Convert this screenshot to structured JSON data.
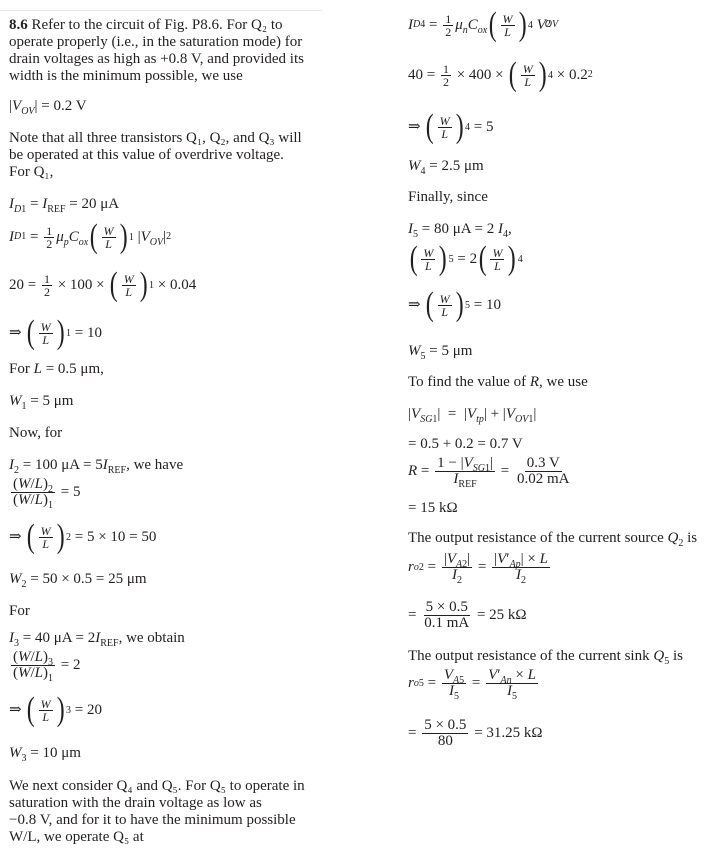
{
  "problem": {
    "number": "8.6",
    "intro": [
      "Refer to the circuit of Fig. P8.6. For Q₂ to",
      "operate properly (i.e., in the saturation mode) for",
      "drain voltages as high as +0.8 V, and provided its",
      "width is the minimum possible, we use"
    ]
  },
  "left": {
    "vov": "|V_OV| = 0.2 V",
    "note": [
      "Note that all three transistors Q₁, Q₂, and Q₃ will",
      "be operated at this value of overdrive voltage.",
      "For Q₁,"
    ],
    "id1_iref": "I_D1 = I_REF = 20 μA",
    "id1_formula": "I_D1 = ½ μ_p C_ox (W/L)_1 |V_OV|²",
    "eq20": "20 = ½ × 100 × (W/L)_1 × 0.04",
    "wl1": "⇒ (W/L)_1 = 10",
    "for_l": "For L = 0.5 μm,",
    "w1": "W₁ = 5 μm",
    "now_for": "Now, for",
    "i2": "I₂ = 100 μA = 5I_REF, we have",
    "ratio2": "(W/L)₂ / (W/L)₁ = 5",
    "wl2": "⇒ (W/L)_2 = 5 × 10 = 50",
    "w2": "W₂ = 50 × 0.5 = 25 μm",
    "for": "For",
    "i3": "I₃ = 40 μA = 2I_REF, we obtain",
    "ratio3": "(W/L)₃ / (W/L)₁ = 2",
    "wl3": "⇒ (W/L)_3 = 20",
    "w3": "W₃ = 10 μm",
    "next": [
      "We next consider Q₄ and Q₅. For Q₅ to operate in",
      "saturation with the drain voltage as low as",
      "−0.8 V, and for it to have the minimum possible",
      "W/L, we operate Q₅ at"
    ]
  },
  "right": {
    "id4_formula": "I_D4 = ½ μ_n C_ox (W/L)_4 V_OV²",
    "eq40": "40 = ½ × 400 × (W/L)_4 × 0.2²",
    "wl4": "⇒ (W/L)_4 = 5",
    "w4": "W₄ = 2.5 μm",
    "finally": "Finally, since",
    "i5": "I₅ = 80 μA = 2 I₄,",
    "wl5_rel": "(W/L)_5 = 2(W/L)_4",
    "wl5": "⇒ (W/L)_5 = 10",
    "w5": "W₅ = 5 μm",
    "find_r": "To find the value of R, we use",
    "vsg1": "|V_SG1| = |V_tp| + |V_OV1|",
    "vsg1_val": "= 0.5 + 0.2 = 0.7 V",
    "r_formula": "R = (1 − |V_SG1|) / I_REF = 0.3 V / 0.02 mA",
    "r_val": "= 15 kΩ",
    "ro2_text": "The output resistance of the current source Q₂ is",
    "ro2_formula": "r_o2 = |V_A2| / I₂ = |V'_Ap| × L / I₂",
    "ro2_val": "= (5 × 0.5) / 0.1 mA = 25 kΩ",
    "ro5_text": "The output resistance of the current sink Q₅ is",
    "ro5_formula": "r_o5 = V_A5 / I₅ = V'_An × L / I₅",
    "ro5_val": "= (5 × 0.5) / 80 = 31.25 kΩ"
  },
  "tokens": {
    "half_num": "1",
    "half_den": "2",
    "W": "W",
    "L": "L",
    "eq": " = ",
    "times": " × ",
    "implies": "⇒ ",
    "lp": "(",
    "rp": ")",
    "s1": "1",
    "s2": "2",
    "s3": "3",
    "s4": "4",
    "s5": "5",
    "n10": "10",
    "n5": "5",
    "n20": "20",
    "n2": "2",
    "n50": "= 5 × 10 = 50",
    "wl2_num": "(W/L)₂",
    "wl3_num": "(W/L)₃",
    "wl1_den": "(W/L)₁",
    "one_minus_vsg": "1 − |V",
    "vsg_sub": "SG1",
    "iref_i": "I",
    "iref_sub": "REF",
    "r03": "0.3 V",
    "r002": "0.02 mA",
    "va2": "|V",
    "va2_sub": "A2",
    "vap": "|V′",
    "vap_sub": "Ap",
    "xl": "| × L",
    "i2": "I",
    "i2_sub": "2",
    "num5x05": "5 × 0.5",
    "den01": "0.1 mA",
    "den80": "80",
    "k25": "= 25 kΩ",
    "k3125": "= 31.25 kΩ",
    "va5": "V",
    "va5_sub": "A5",
    "van": "V′",
    "van_sub": "An",
    "xL": " × L",
    "i5_sub": "5"
  }
}
